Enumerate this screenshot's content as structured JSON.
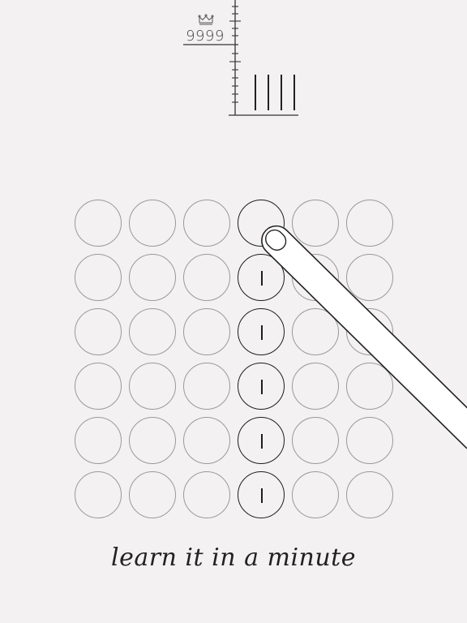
{
  "hud": {
    "high_score_icon": "crown-icon",
    "high_score": "9999",
    "current_score_tally": 4
  },
  "board": {
    "rows": 6,
    "cols": 6,
    "active_cells": [
      [
        0,
        3
      ],
      [
        1,
        3
      ],
      [
        2,
        3
      ],
      [
        3,
        3
      ],
      [
        4,
        3
      ],
      [
        5,
        3
      ]
    ],
    "marked_cells": [
      [
        1,
        3
      ],
      [
        2,
        3
      ],
      [
        3,
        3
      ],
      [
        4,
        3
      ],
      [
        5,
        3
      ]
    ]
  },
  "tutorial": {
    "pointer_icon": "finger-pointer-icon",
    "tagline": "learn it in a minute"
  },
  "colors": {
    "background": "#f3f1f2",
    "ink": "#1e1e1e",
    "inactive_circle": "#9a9a9a"
  }
}
